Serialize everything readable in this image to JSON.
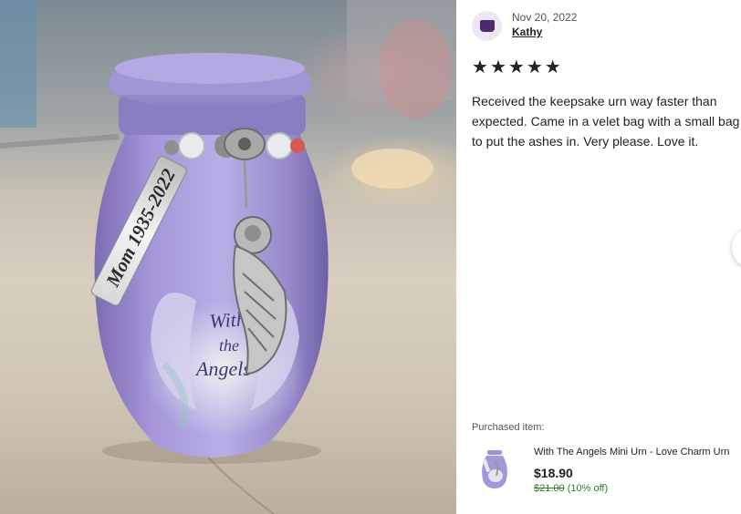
{
  "review": {
    "date": "Nov 20, 2022",
    "reviewer": "Kathy",
    "rating": 5,
    "stars": [
      "★",
      "★",
      "★",
      "★",
      "★"
    ],
    "text": "Received the keepsake urn way faster than expected. Came in a velet bag with a small bag to put the ashes in. Very please. Love it."
  },
  "photo": {
    "tag_engraving": "Mom 1935-2022",
    "urn_text": [
      "With",
      "the",
      "Angels"
    ]
  },
  "purchased": {
    "label": "Purchased item:",
    "name": "With The Angels Mini Urn - Love Charm Urn",
    "price": "$18.90",
    "original_price": "$21.00",
    "discount": "(10% off)"
  },
  "colors": {
    "urn_purple": "#9d8fcf",
    "sale_green": "#2f7d2f",
    "avatar_purple": "#4d2a6e"
  },
  "icons": {
    "avatar": "user-avatar-icon",
    "star": "star-icon",
    "next": "chevron-right-icon"
  }
}
